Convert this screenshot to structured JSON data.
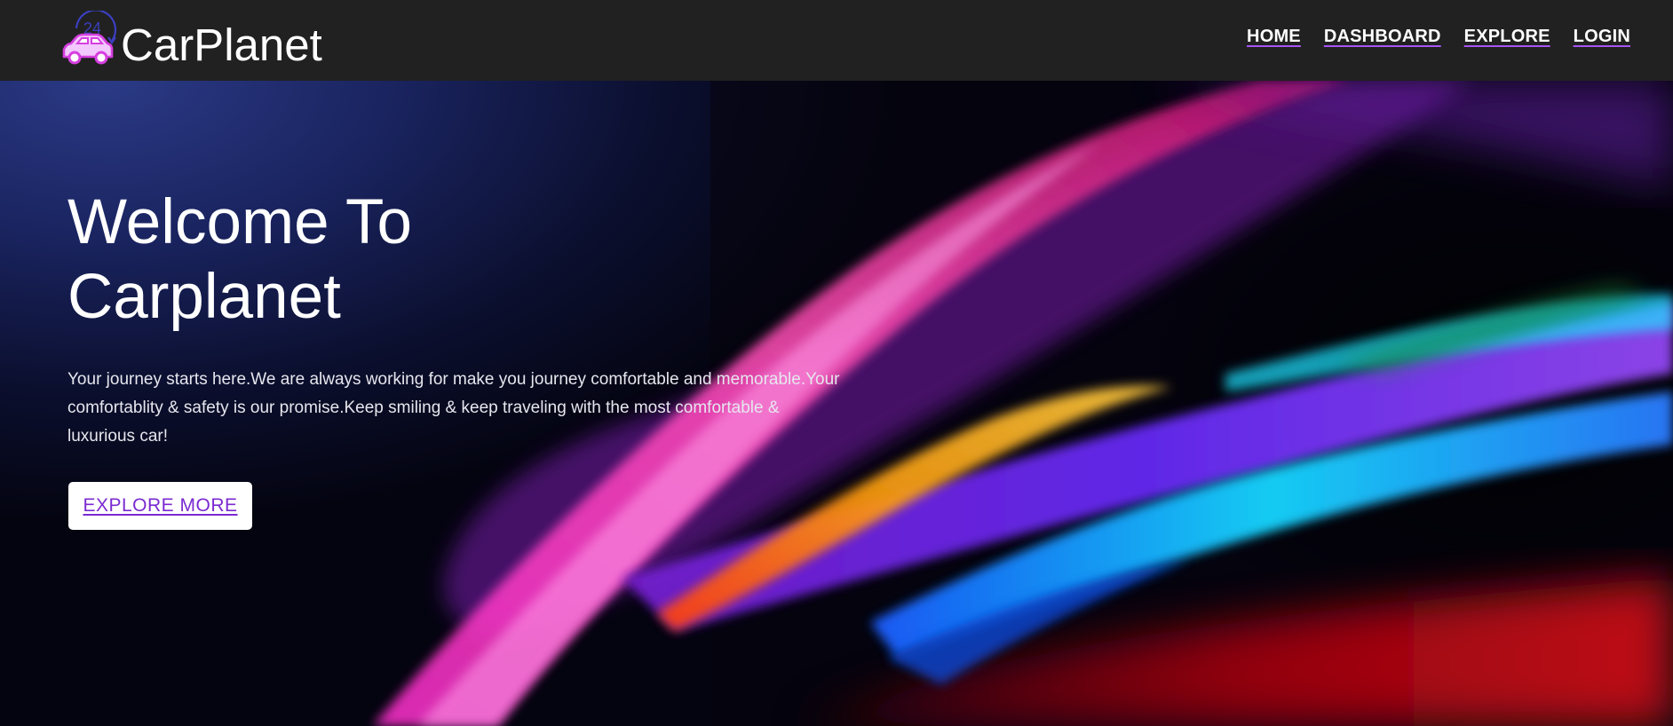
{
  "brand": {
    "name": "CarPlanet",
    "logo_badge": "24",
    "logo_icon": "car-24h-icon"
  },
  "nav": {
    "items": [
      {
        "label": "HOME"
      },
      {
        "label": "DASHBOARD"
      },
      {
        "label": "EXPLORE"
      },
      {
        "label": "LOGIN"
      }
    ]
  },
  "hero": {
    "title_line1": "Welcome To",
    "title_line2": "Carplanet",
    "description": "Your journey starts here.We are always working for make you journey comfortable and memorable.Your comfortablity & safety is our promise.Keep smiling & keep traveling with the most comfortable & luxurious car!",
    "cta_label": "EXPLORE MORE"
  },
  "colors": {
    "navbar_bg": "#212121",
    "accent": "#a855f7",
    "cta_text": "#7b2ad1",
    "hero_bg": "#0b0f2e"
  }
}
